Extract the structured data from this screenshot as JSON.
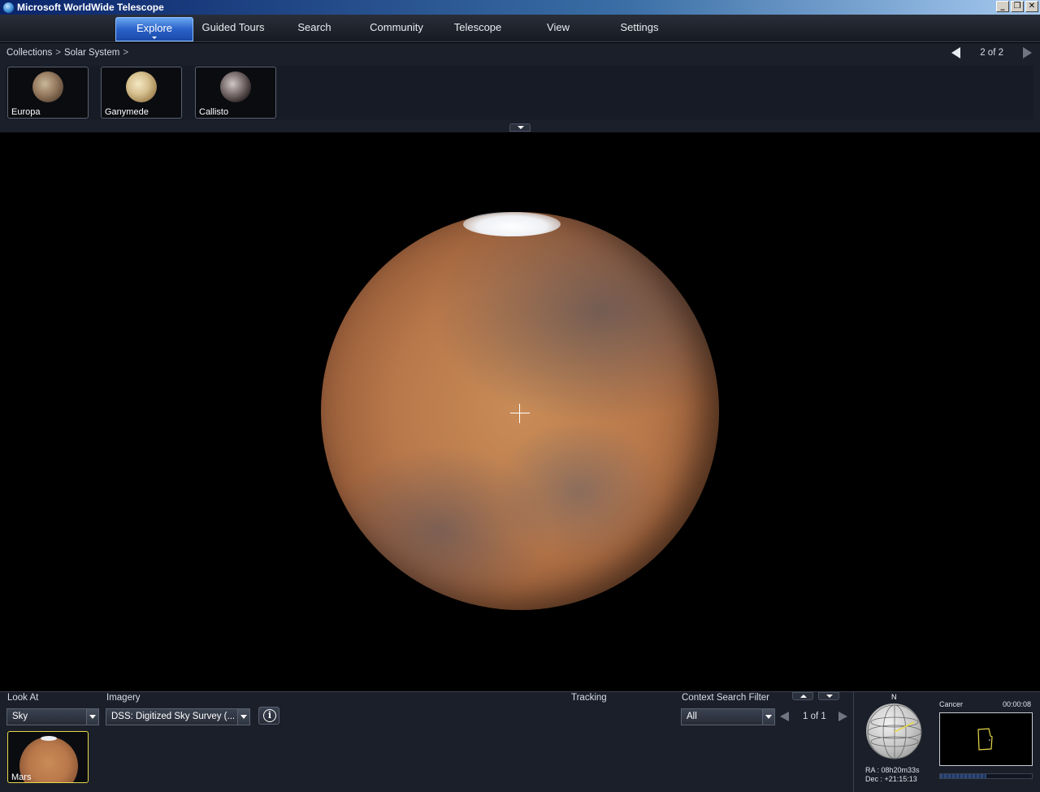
{
  "window": {
    "title": "Microsoft WorldWide Telescope",
    "controls": [
      "minimize-icon",
      "restore-icon",
      "close-icon"
    ]
  },
  "menu": {
    "items": [
      {
        "label": "Explore",
        "active": true
      },
      {
        "label": "Guided Tours"
      },
      {
        "label": "Search"
      },
      {
        "label": "Community"
      },
      {
        "label": "Telescope"
      },
      {
        "label": "View"
      },
      {
        "label": "Settings"
      }
    ]
  },
  "explore": {
    "breadcrumb": [
      "Collections",
      "Solar System"
    ],
    "pager": "2 of 2",
    "thumbnails": [
      {
        "label": "Europa"
      },
      {
        "label": "Ganymede"
      },
      {
        "label": "Callisto"
      }
    ]
  },
  "bottom": {
    "look_at_label": "Look At",
    "look_at_value": "Sky",
    "imagery_label": "Imagery",
    "imagery_value": "DSS: Digitized Sky Survey (...",
    "tracking_label": "Tracking",
    "context_filter_label": "Context Search Filter",
    "context_filter_value": "All",
    "context_pager": "1 of 1",
    "result_thumbnail_label": "Mars"
  },
  "navigation": {
    "north_label": "N",
    "ra": "RA :  08h20m33s",
    "dec": "Dec : +21:15:13",
    "constellation": "Cancer",
    "clock": "00:00:08",
    "progress": 0.5
  },
  "colors": {
    "active_tab": "#2a62c8",
    "selection_border": "#e8d84a",
    "panel_bg": "#1a1f2a",
    "constellation_outline": "#e8d84a"
  }
}
